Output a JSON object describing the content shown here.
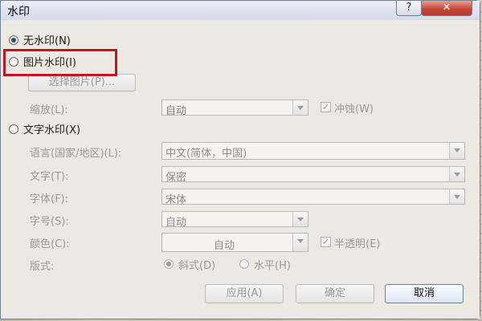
{
  "window": {
    "title": "水印",
    "help_label": "?",
    "close_label": "✕"
  },
  "options": {
    "no_watermark": "无水印(N)",
    "picture_watermark": "图片水印(I)",
    "text_watermark": "文字水印(X)"
  },
  "picture": {
    "select_button": "选择图片(P)...",
    "scale_label": "缩放(L):",
    "scale_value": "自动",
    "washout_label": "冲蚀(W)",
    "washout_checked": true
  },
  "text": {
    "language_label": "语言(国家/地区)(L):",
    "language_value": "中文(简体，中国)",
    "text_label": "文字(T):",
    "text_value": "保密",
    "font_label": "字体(F):",
    "font_value": "宋体",
    "size_label": "字号(S):",
    "size_value": "自动",
    "color_label": "颜色(C):",
    "color_value": "自动",
    "semitransparent_label": "半透明(E)",
    "semitransparent_checked": true,
    "layout_label": "版式:",
    "diagonal_label": "斜式(D)",
    "horizontal_label": "水平(H)"
  },
  "buttons": {
    "apply": "应用(A)",
    "ok": "确定",
    "cancel": "取消"
  },
  "selected_option": "no_watermark",
  "highlight_color": "#c2151e"
}
